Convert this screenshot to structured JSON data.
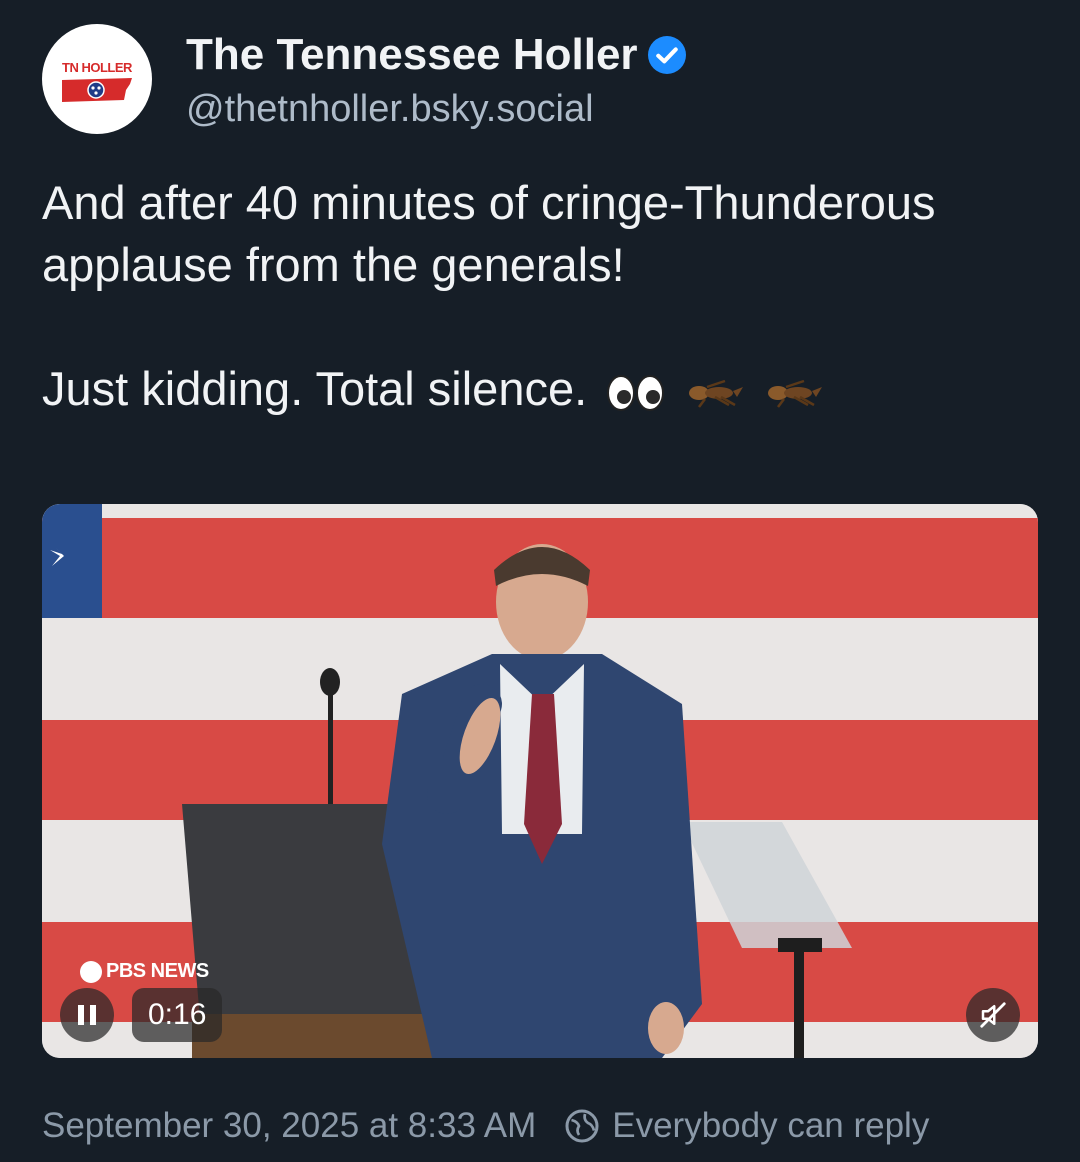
{
  "author": {
    "display_name": "The Tennessee Holler",
    "handle": "@thetnholler.bsky.social",
    "avatar_text": "TN HOLLER",
    "verified": true
  },
  "post": {
    "paragraph1": "And after 40 minutes of cringe-Thunderous applause from the generals!",
    "paragraph2": "Just kidding. Total silence.",
    "emojis": [
      "eyes-emoji",
      "cricket-emoji",
      "cricket-emoji"
    ]
  },
  "video": {
    "watermark": "PBS NEWS",
    "timestamp": "0:16",
    "pause_icon": "pause-icon",
    "mute_icon": "muted-speaker-icon"
  },
  "footer": {
    "date": "September 30, 2025 at 8:33 AM",
    "reply_setting": "Everybody can reply",
    "globe_icon": "globe-icon"
  },
  "colors": {
    "background": "#161e27",
    "text": "#f1f3f5",
    "muted": "#8b99a8",
    "verified": "#1c8cff",
    "flag_red": "#d84a45",
    "flag_blue": "#2a4f8f"
  }
}
